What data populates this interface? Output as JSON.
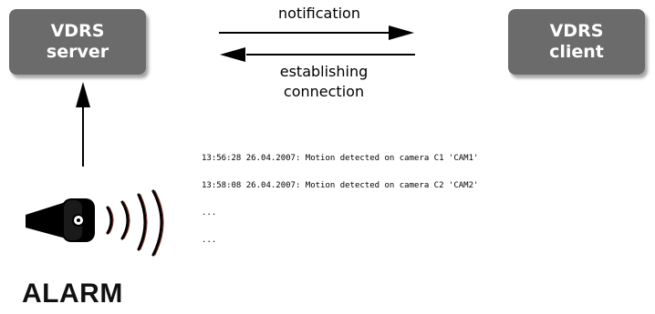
{
  "nodes": {
    "server": {
      "line1": "VDRS",
      "line2": "server"
    },
    "client": {
      "line1": "VDRS",
      "line2": "client"
    }
  },
  "edges": {
    "notification": "notification",
    "establishing_line1": "establishing",
    "establishing_line2": "connection"
  },
  "log": {
    "lines": [
      "13:56:28 26.04.2007: Motion detected on camera C1 'CAM1'",
      "13:58:08 26.04.2007: Motion detected on camera C2 'CAM2'",
      "...",
      "..."
    ]
  },
  "alarm": {
    "label": "ALARM",
    "icon": "speaker-icon"
  },
  "colors": {
    "node_fill": "#6b6b6b",
    "node_text": "#ffffff",
    "arrow": "#000000",
    "sound_wave": "#7a2b20"
  }
}
